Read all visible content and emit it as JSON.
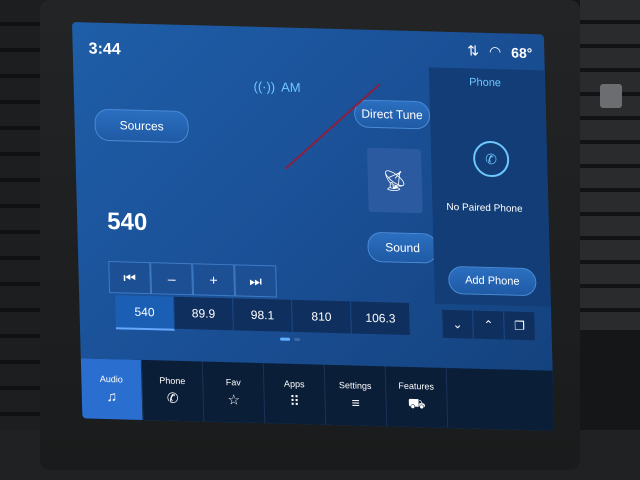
{
  "status": {
    "time": "3:44",
    "temperature": "68°"
  },
  "radio": {
    "band": "AM",
    "frequency": "540",
    "sources_label": "Sources",
    "direct_tune_label": "Direct Tune",
    "sound_label": "Sound",
    "controls": [
      {
        "icon": "seek-back-icon",
        "glyph": "⏮"
      },
      {
        "icon": "minus-icon",
        "glyph": "–"
      },
      {
        "icon": "plus-icon",
        "glyph": "+"
      },
      {
        "icon": "seek-forward-icon",
        "glyph": "⏭"
      }
    ],
    "presets": [
      "540",
      "89.9",
      "98.1",
      "810",
      "106.3"
    ]
  },
  "phone": {
    "title": "Phone",
    "status": "No Paired Phone",
    "add_label": "Add Phone",
    "mini_controls": [
      {
        "icon": "chevron-down-icon",
        "glyph": "⌄"
      },
      {
        "icon": "chevron-up-icon",
        "glyph": "⌃"
      },
      {
        "icon": "copy-icon",
        "glyph": "❐"
      }
    ]
  },
  "nav": [
    {
      "label": "Audio",
      "icon": "music-note-icon",
      "glyph": "♫",
      "active": true
    },
    {
      "label": "Phone",
      "icon": "phone-icon",
      "glyph": "✆",
      "active": false
    },
    {
      "label": "Fav",
      "icon": "star-icon",
      "glyph": "☆",
      "active": false
    },
    {
      "label": "Apps",
      "icon": "apps-grid-icon",
      "glyph": "⠿",
      "active": false
    },
    {
      "label": "Settings",
      "icon": "sliders-icon",
      "glyph": "≡",
      "active": false
    },
    {
      "label": "Features",
      "icon": "car-icon",
      "glyph": "⛟",
      "active": false
    }
  ],
  "colors": {
    "accent": "#2a6fd0",
    "highlight": "#6ec6ff"
  }
}
